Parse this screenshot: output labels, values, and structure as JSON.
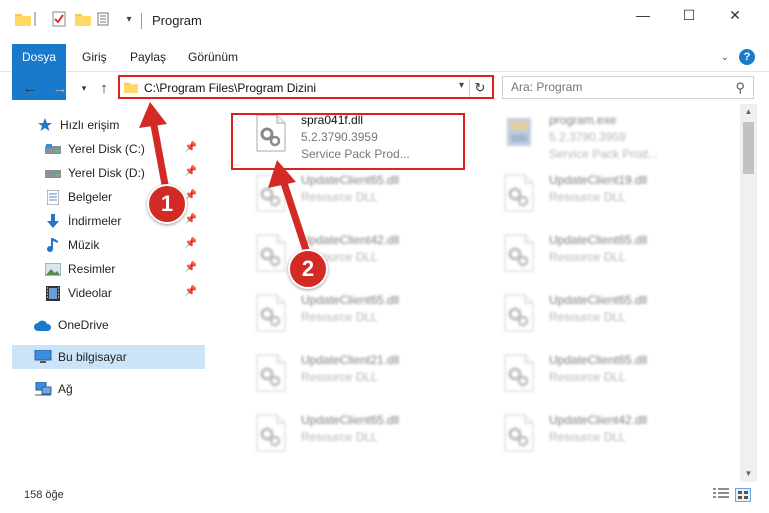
{
  "window": {
    "title": "Program"
  },
  "window_controls": {
    "minimize": "—",
    "maximize": "☐",
    "close": "✕"
  },
  "ribbon": {
    "tabs": [
      "Dosya",
      "Giriş",
      "Paylaş",
      "Görünüm"
    ],
    "help": "?"
  },
  "address": {
    "path": "C:\\Program Files\\Program Dizini"
  },
  "search": {
    "placeholder": "Ara: Program"
  },
  "sidebar": {
    "items": [
      {
        "label": "Hızlı erişim",
        "icon": "star-icon",
        "pinned": false
      },
      {
        "label": "Yerel Disk (C:)",
        "icon": "drive-icon",
        "pinned": true
      },
      {
        "label": "Yerel Disk (D:)",
        "icon": "drive-icon",
        "pinned": true
      },
      {
        "label": "Belgeler",
        "icon": "document-icon",
        "pinned": true
      },
      {
        "label": "İndirmeler",
        "icon": "download-icon",
        "pinned": true
      },
      {
        "label": "Müzik",
        "icon": "music-icon",
        "pinned": true
      },
      {
        "label": "Resimler",
        "icon": "pictures-icon",
        "pinned": true
      },
      {
        "label": "Videolar",
        "icon": "video-icon",
        "pinned": true
      },
      {
        "label": "OneDrive",
        "icon": "cloud-icon",
        "pinned": false
      },
      {
        "label": "Bu bilgisayar",
        "icon": "computer-icon",
        "pinned": false,
        "selected": true
      },
      {
        "label": "Ağ",
        "icon": "network-icon",
        "pinned": false
      }
    ]
  },
  "files": [
    {
      "name": "spra041f.dll",
      "line2": "5.2.3790.3959",
      "line3": "Service Pack     Prod...",
      "type": "dll",
      "highlighted": true
    },
    {
      "name": "program.exe",
      "line2": "5.2.3790.3959",
      "line3": "Service Pack     Prod...",
      "type": "exe",
      "blurred": true
    },
    {
      "name": "UpdateClient65.dll",
      "line2": "Resource DLL",
      "line3": "",
      "type": "dll",
      "blurred": true
    },
    {
      "name": "UpdateClient19.dll",
      "line2": "Resource DLL",
      "line3": "",
      "type": "dll",
      "blurred": true
    },
    {
      "name": "UpdateClient42.dll",
      "line2": "Resource DLL",
      "line3": "",
      "type": "dll",
      "blurred": true
    },
    {
      "name": "UpdateClient65.dll",
      "line2": "Resource DLL",
      "line3": "",
      "type": "dll",
      "blurred": true
    },
    {
      "name": "UpdateClient65.dll",
      "line2": "Resource DLL",
      "line3": "",
      "type": "dll",
      "blurred": true
    },
    {
      "name": "UpdateClient65.dll",
      "line2": "Resource DLL",
      "line3": "",
      "type": "dll",
      "blurred": true
    },
    {
      "name": "UpdateClient21.dll",
      "line2": "Resource DLL",
      "line3": "",
      "type": "dll",
      "blurred": true
    },
    {
      "name": "UpdateClient65.dll",
      "line2": "Resource DLL",
      "line3": "",
      "type": "dll",
      "blurred": true
    },
    {
      "name": "UpdateClient65.dll",
      "line2": "Resource DLL",
      "line3": "",
      "type": "dll",
      "blurred": true
    },
    {
      "name": "UpdateClient42.dll",
      "line2": "Resource DLL",
      "line3": "",
      "type": "dll",
      "blurred": true
    }
  ],
  "status": {
    "item_count": "158 öğe"
  },
  "callouts": [
    "1",
    "2"
  ],
  "colors": {
    "accent": "#1979ca",
    "callout": "#d42a26",
    "highlight_border": "#e0201d",
    "selection": "#cce4f7"
  }
}
